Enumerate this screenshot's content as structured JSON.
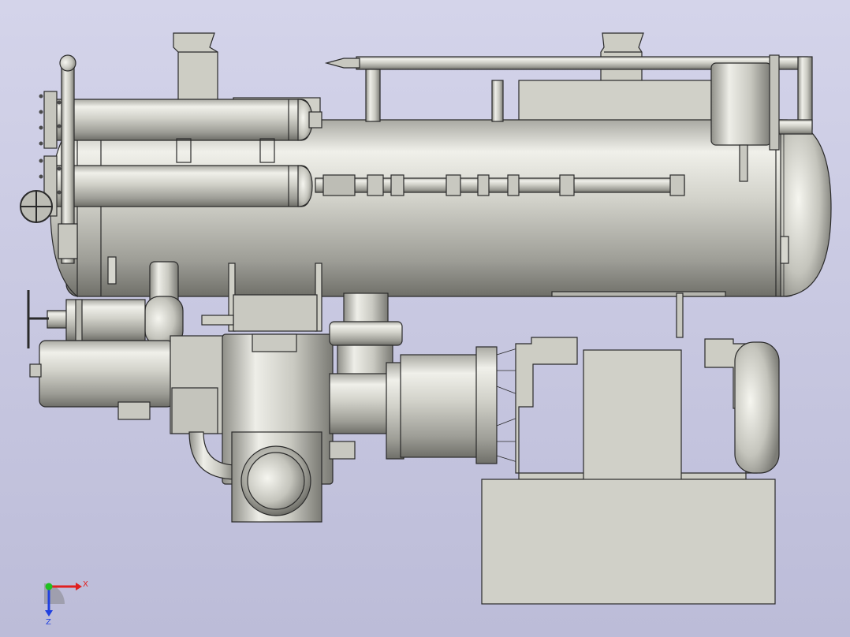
{
  "viewport": {
    "background_top": "#d4d4ea",
    "background_bottom": "#bcbcd8"
  },
  "model": {
    "part_fill": "#cfcfc6",
    "part_edge": "#2a2a2a",
    "shade_dark": "#7f7f78",
    "shade_light": "#f4f4ee"
  },
  "triad": {
    "x_label": "X",
    "z_label": "Z",
    "x_color": "#e02020",
    "y_color": "#20c020",
    "z_color": "#2040e0",
    "icon": "coordinate-triad-icon"
  }
}
